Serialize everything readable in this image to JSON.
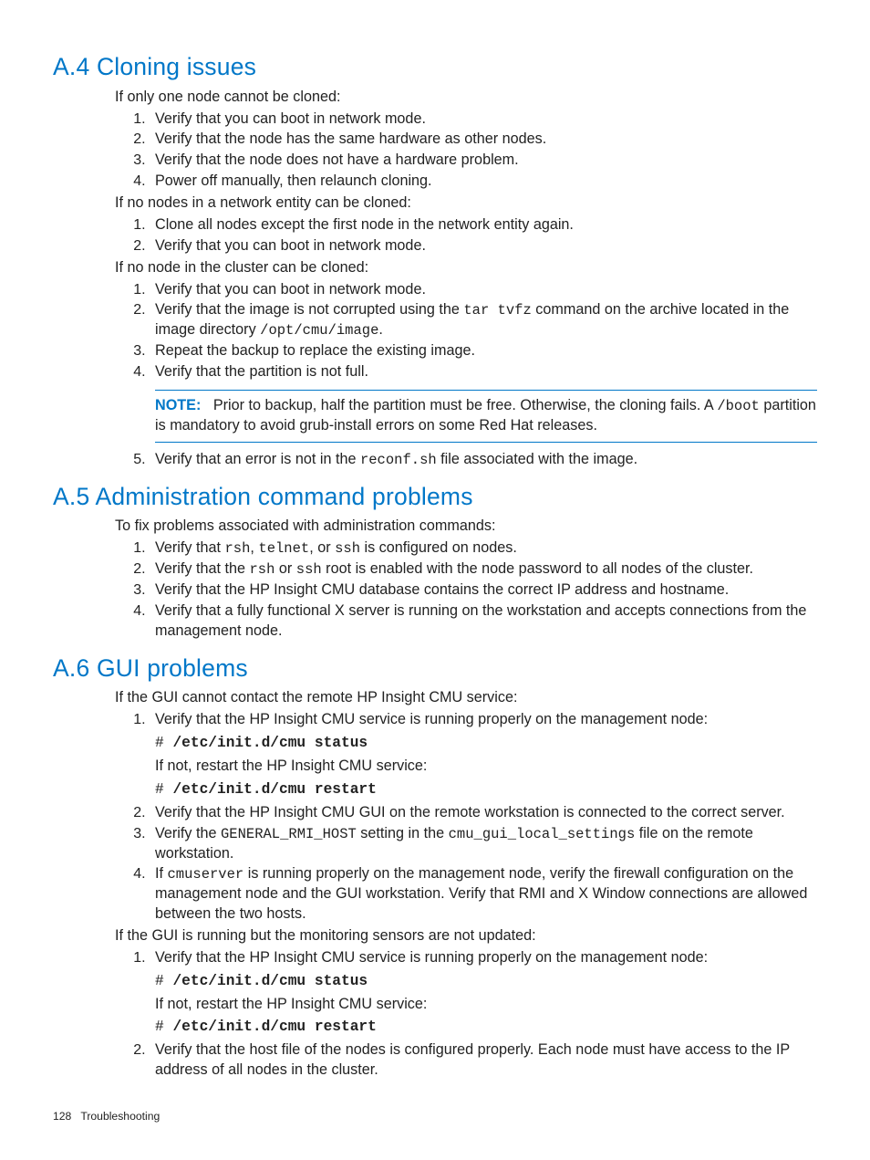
{
  "a4": {
    "heading": "A.4 Cloning issues",
    "intro1": "If only one node cannot be cloned:",
    "list1": [
      "Verify that you can boot in network mode.",
      "Verify that the node has the same hardware as other nodes.",
      "Verify that the node does not have a hardware problem.",
      "Power off manually, then relaunch cloning."
    ],
    "intro2": "If no nodes in a network entity can be cloned:",
    "list2": [
      "Clone all nodes except the first node in the network entity again.",
      "Verify that you can boot in network mode."
    ],
    "intro3": "If no node in the cluster can be cloned:",
    "list3_1": "Verify that you can boot in network mode.",
    "list3_2a": "Verify that the image is not corrupted using the ",
    "list3_2_code1": "tar tvfz",
    "list3_2b": " command on the archive located in the image directory ",
    "list3_2_code2": "/opt/cmu/image",
    "list3_2c": ".",
    "list3_3": "Repeat the backup to replace the existing image.",
    "list3_4": "Verify that the partition is not full.",
    "note_label": "NOTE:",
    "note_a": "Prior to backup, half the partition must be free. Otherwise, the cloning fails. A ",
    "note_code": "/boot",
    "note_b": " partition is mandatory to avoid grub-install errors on some Red Hat releases.",
    "list3_5a": "Verify that an error is not in the ",
    "list3_5_code": "reconf.sh",
    "list3_5b": " file associated with the image."
  },
  "a5": {
    "heading": "A.5 Administration command problems",
    "intro": "To fix problems associated with administration commands:",
    "li1a": "Verify that ",
    "li1_c1": "rsh",
    "li1b": ", ",
    "li1_c2": "telnet",
    "li1c": ", or ",
    "li1_c3": "ssh",
    "li1d": " is configured on nodes.",
    "li2a": "Verify that the ",
    "li2_c1": "rsh",
    "li2b": " or ",
    "li2_c2": "ssh",
    "li2c": " root is enabled with the node password to all nodes of the cluster.",
    "li3": "Verify that the HP Insight CMU database contains the correct IP address and hostname.",
    "li4": "Verify that a fully functional X server is running on the workstation and accepts connections from the management node."
  },
  "a6": {
    "heading": "A.6 GUI problems",
    "intro1": "If the GUI cannot contact the remote HP Insight CMU service:",
    "li1": "Verify that the HP Insight CMU service is running properly on the management node:",
    "prompt": "# ",
    "cmd_status": "/etc/init.d/cmu status",
    "restart_text": "If not, restart the HP Insight CMU service:",
    "cmd_restart": "/etc/init.d/cmu restart",
    "li2": "Verify that the HP Insight CMU GUI on the remote workstation is connected to the correct server.",
    "li3a": "Verify the ",
    "li3_c1": "GENERAL_RMI_HOST",
    "li3b": " setting in the ",
    "li3_c2": "cmu_gui_local_settings",
    "li3c": " file on the remote workstation.",
    "li4a": "If ",
    "li4_c1": "cmuserver",
    "li4b": " is running properly on the management node, verify the firewall configuration on the management node and the GUI workstation. Verify that RMI and X Window connections are allowed between the two hosts.",
    "intro2": "If the GUI is running but the monitoring sensors are not updated:",
    "b_li1": "Verify that the HP Insight CMU service is running properly on the management node:",
    "b_li2": "Verify that the host file of the nodes is configured properly. Each node must have access to the IP address of all nodes in the cluster."
  },
  "footer": {
    "page": "128",
    "title": "Troubleshooting"
  }
}
